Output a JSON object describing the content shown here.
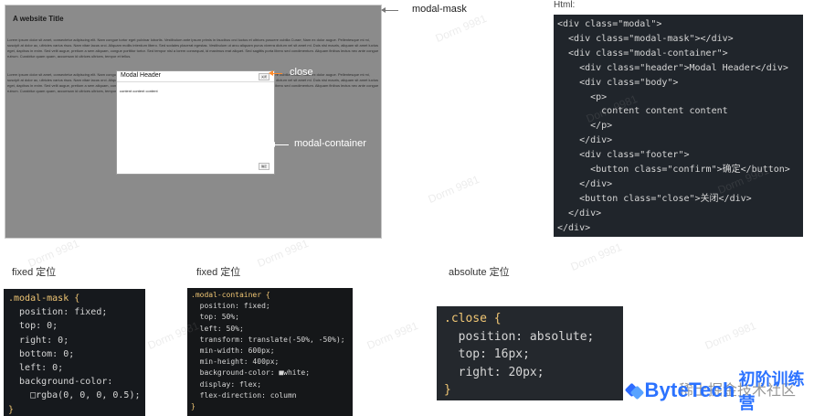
{
  "top_annotations": {
    "modal_mask": "modal-mask",
    "html": "Html:",
    "close": "close",
    "modal_container": "modal-container"
  },
  "screenshot": {
    "title": "A website Title",
    "paragraph_1": "Lorem ipsum dolor sit amet, consectetur adipiscing elit. Nam congue tortor eget pulvinar lobortis. Vestibulum ante ipsum primis in faucibus orci luctus et ultrices posuere cubilia Curae; Nam ex dolor augue. Pellentesque mi mi, suscipit at dolor ac, ultricies varius risus. Nam vitae lacus orci. Aliquam mollis interdum libero. Sed sodales placerat egestas. Vestibulum ut arcu aliquam purus viverra dictum vel sit amet mi. Duis nisl mauris, aliquam sit amet luctus eget, dapibus in enim. Sed velit augue, pretium a sem aliquam, congue porttitor tortor. Sed tempor nisl a lorem consequat, id maximus erat aliquet. Sed sagittis porta libero sed condimentum. Aliquam finibus lectus nec ante congue rutrum. Curabitur quam quam, accumsan id ultrices ultrices, tempor et tellus.",
    "paragraph_2": "Lorem ipsum dolor sit amet, consectetur adipiscing elit. Nam congue tortor eget pulvinar lobortis. Vestibulum ante ipsum primis in faucibus orci luctus et ultrices posuere cubilia Curae; Nam ex dolor augue. Pellentesque mi mi, suscipit at dolor ac, ultricies varius risus. Nam vitae lacus orci. Aliquam mollis interdum libero. Sed sodales placerat egestas. Vestibulum ut arcu aliquam purus viverra dictum vel sit amet mi. Duis nisl mauris, aliquam sit amet luctus eget, dapibus in enim. Sed velit augue, pretium a sem aliquam, congue porttitor tortor. Sed tempor nisl a lorem consequat, id maximus erat aliquet. Sed sagittis porta libero sed condimentum. Aliquam finibus lectus nec ante congue rutrum. Curabitur quam quam, accumsan id ultrices ultrices, tempor et tellus.",
    "modal_header": "Modal Header",
    "modal_body": "content content content",
    "close_button": "关闭",
    "confirm_button": "确定"
  },
  "labels": {
    "fixed_1": "fixed 定位",
    "fixed_2": "fixed 定位",
    "absolute": "absolute 定位"
  },
  "html_code": [
    "<div class=\"modal\">",
    "  <div class=\"modal-mask\"></div>",
    "  <div class=\"modal-container\">",
    "    <div class=\"header\">Modal Header</div>",
    "    <div class=\"body\">",
    "      <p>",
    "        content content content",
    "      </p>",
    "    </div>",
    "    <div class=\"footer\">",
    "      <button class=\"confirm\">确定</button>",
    "    </div>",
    "    <button class=\"close\">关闭</div>",
    "  </div>",
    "</div>"
  ],
  "mask_code": [
    ".modal-mask {",
    "  position: fixed;",
    "  top: 0;",
    "  right: 0;",
    "  bottom: 0;",
    "  left: 0;",
    "  background-color:",
    "    □rgba(0, 0, 0, 0.5);",
    "}"
  ],
  "container_code": [
    ".modal-container {",
    "  position: fixed;",
    "  top: 50%;",
    "  left: 50%;",
    "  transform: translate(-50%, -50%);",
    "  min-width: 600px;",
    "  min-height: 400px;",
    "  background-color: ■white;",
    "  display: flex;",
    "  flex-direction: column",
    "}"
  ],
  "close_code": [
    ".close {",
    "  position: absolute;",
    "  top: 16px;",
    "  right: 20px;",
    "}"
  ],
  "watermarks": [
    "Dorm 9981",
    "Dorm 9981",
    "Dorm 9981",
    "Dorm 9981",
    "Dorm 9981",
    "Dorm 9981",
    "Dorm 9981",
    "Dorm 9981",
    "Dorm 9981",
    "Dorm 9981"
  ],
  "branding": {
    "site": "稀土掘金技术社区",
    "brand": "ByteTech",
    "program": "初阶训练营"
  }
}
